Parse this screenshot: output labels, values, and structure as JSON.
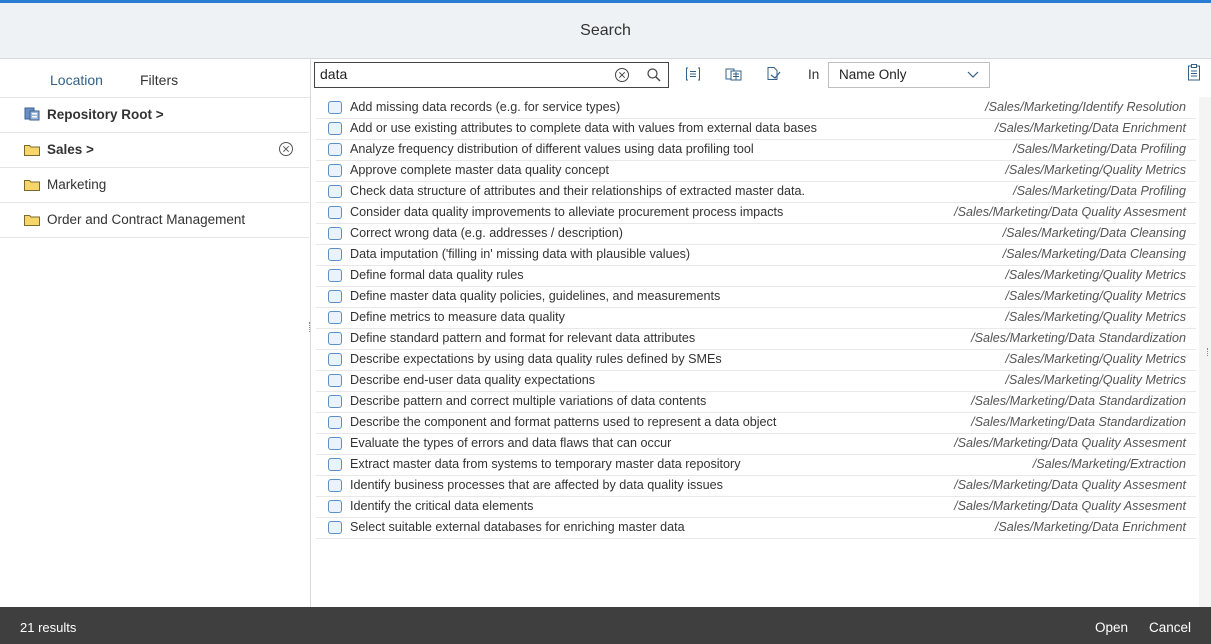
{
  "dialog": {
    "title": "Search"
  },
  "left_tabs": {
    "location": "Location",
    "filters": "Filters"
  },
  "folders": [
    {
      "label": "Repository Root >",
      "bold": true,
      "icon": "repository-icon"
    },
    {
      "label": "Sales >",
      "bold": true,
      "icon": "folder-icon",
      "clearable": true
    },
    {
      "label": "Marketing",
      "bold": false,
      "icon": "folder-icon"
    },
    {
      "label": "Order and Contract Management",
      "bold": false,
      "icon": "folder-icon"
    }
  ],
  "search": {
    "value": "data",
    "in_label": "In",
    "scope": "Name Only"
  },
  "results": [
    {
      "name": "Add missing data records (e.g. for service types)",
      "path": "/Sales/Marketing/Identify Resolution"
    },
    {
      "name": "Add or use existing attributes to complete data with values from external data bases",
      "path": "/Sales/Marketing/Data Enrichment"
    },
    {
      "name": "Analyze frequency distribution of different values using data profiling tool",
      "path": "/Sales/Marketing/Data Profiling"
    },
    {
      "name": "Approve complete master data quality concept",
      "path": "/Sales/Marketing/Quality Metrics"
    },
    {
      "name": "Check data structure of attributes and their relationships of extracted master data.",
      "path": "/Sales/Marketing/Data Profiling"
    },
    {
      "name": "Consider data quality improvements to alleviate procurement process impacts",
      "path": "/Sales/Marketing/Data Quality Assesment"
    },
    {
      "name": "Correct wrong data (e.g. addresses / description)",
      "path": "/Sales/Marketing/Data Cleansing"
    },
    {
      "name": "Data imputation ('filling in' missing data with plausible values)",
      "path": "/Sales/Marketing/Data Cleansing"
    },
    {
      "name": "Define formal data quality rules",
      "path": "/Sales/Marketing/Quality Metrics"
    },
    {
      "name": "Define master data quality policies, guidelines, and measurements",
      "path": "/Sales/Marketing/Quality Metrics"
    },
    {
      "name": "Define metrics to measure data quality",
      "path": "/Sales/Marketing/Quality Metrics"
    },
    {
      "name": "Define standard pattern and format for relevant data attributes",
      "path": "/Sales/Marketing/Data Standardization"
    },
    {
      "name": "Describe expectations by using data quality rules defined by SMEs",
      "path": "/Sales/Marketing/Quality Metrics"
    },
    {
      "name": "Describe end-user data quality expectations",
      "path": "/Sales/Marketing/Quality Metrics"
    },
    {
      "name": "Describe pattern and correct multiple variations of data contents",
      "path": "/Sales/Marketing/Data Standardization"
    },
    {
      "name": "Describe the component and format patterns used to represent a data object",
      "path": "/Sales/Marketing/Data Standardization"
    },
    {
      "name": "Evaluate the types of errors and data flaws that can occur",
      "path": "/Sales/Marketing/Data Quality Assesment"
    },
    {
      "name": "Extract master data from systems to temporary master data repository",
      "path": "/Sales/Marketing/Extraction"
    },
    {
      "name": "Identify business processes that are affected by data quality issues",
      "path": "/Sales/Marketing/Data Quality Assesment"
    },
    {
      "name": "Identify the critical data elements",
      "path": "/Sales/Marketing/Data Quality Assesment"
    },
    {
      "name": "Select suitable external databases for enriching master data",
      "path": "/Sales/Marketing/Data Enrichment"
    }
  ],
  "footer": {
    "count": "21 results",
    "open": "Open",
    "cancel": "Cancel"
  },
  "colors": {
    "accent": "#2b7cd3",
    "footer_bg": "#3f3f3f",
    "link": "#346187"
  }
}
